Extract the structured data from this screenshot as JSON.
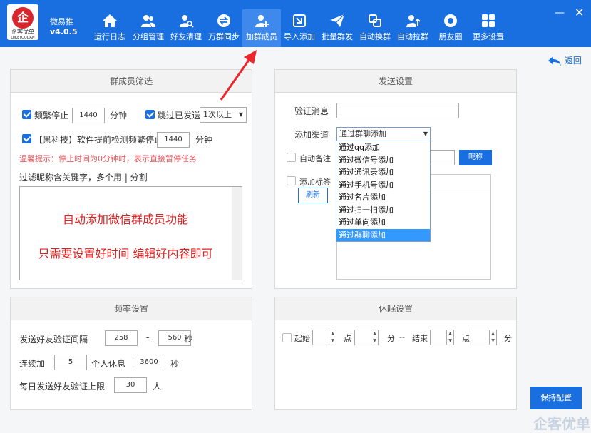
{
  "app": {
    "name": "微易推",
    "version": "v4.0.5",
    "logo_text": "企客优单",
    "logo_sub": "QIKEYOUDAN"
  },
  "nav": [
    {
      "label": "运行日志",
      "icon": "home-icon"
    },
    {
      "label": "分组管理",
      "icon": "users-icon"
    },
    {
      "label": "好友清理",
      "icon": "user-search-icon"
    },
    {
      "label": "万群同步",
      "icon": "sync-icon"
    },
    {
      "label": "加群成员",
      "icon": "add-user-icon",
      "active": true
    },
    {
      "label": "导入添加",
      "icon": "import-icon"
    },
    {
      "label": "批量群发",
      "icon": "send-icon"
    },
    {
      "label": "自动换群",
      "icon": "switch-icon"
    },
    {
      "label": "自动拉群",
      "icon": "pull-user-icon"
    },
    {
      "label": "朋友圈",
      "icon": "camera-icon"
    },
    {
      "label": "更多设置",
      "icon": "grid-icon"
    }
  ],
  "back_label": "返回",
  "filter": {
    "title": "群成员筛选",
    "freq_stop_label": "频繁停止",
    "freq_stop_value": "1440",
    "freq_stop_unit": "分钟",
    "skip_sent_label": "跳过已发送",
    "skip_sent_option": "1次以上",
    "blacktech_label": "【黑科技】软件提前检测频繁停止",
    "blacktech_value": "1440",
    "blacktech_unit": "分钟",
    "hint": "温馨提示：停止时间为0分钟时，表示直接暂停任务",
    "keyword_label": "过滤昵称含关键字，多个用 | 分割",
    "overlay_line1": "自动添加微信群成员功能",
    "overlay_line2": "只需要设置好时间 编辑好内容即可"
  },
  "send": {
    "title": "发送设置",
    "verify_label": "验证消息",
    "verify_value": "",
    "channel_label": "添加渠道",
    "channel_selected": "通过群聊添加",
    "auto_note_label": "自动备注",
    "nickname_button": "昵称",
    "tag_label": "添加标签",
    "refresh_button": "刷新",
    "channel_options": [
      "通过qq添加",
      "通过微信号添加",
      "通过通讯录添加",
      "通过手机号添加",
      "通过名片添加",
      "通过扫一扫添加",
      "通过单向添加",
      "通过群聊添加"
    ]
  },
  "rate": {
    "title": "频率设置",
    "interval_label": "发送好友验证间隔",
    "interval_min": "258",
    "interval_dash": "-",
    "interval_max": "560",
    "interval_unit": "秒",
    "batch_label": "连续加",
    "batch_value": "5",
    "batch_mid": "个人休息",
    "batch_rest": "3600",
    "batch_unit": "秒",
    "daily_label": "每日发送好友验证上限",
    "daily_value": "30",
    "daily_unit": "人"
  },
  "sleep": {
    "title": "休眠设置",
    "start_label": "起始",
    "hour": "点",
    "minute": "分",
    "dash": "--",
    "end_label": "结束"
  },
  "save_button": "保持配置",
  "watermark": "企客优单",
  "colors": {
    "primary": "#1a6fe0",
    "hint": "#e8565d",
    "overlay": "#e02020",
    "arrow": "#e8262c"
  }
}
